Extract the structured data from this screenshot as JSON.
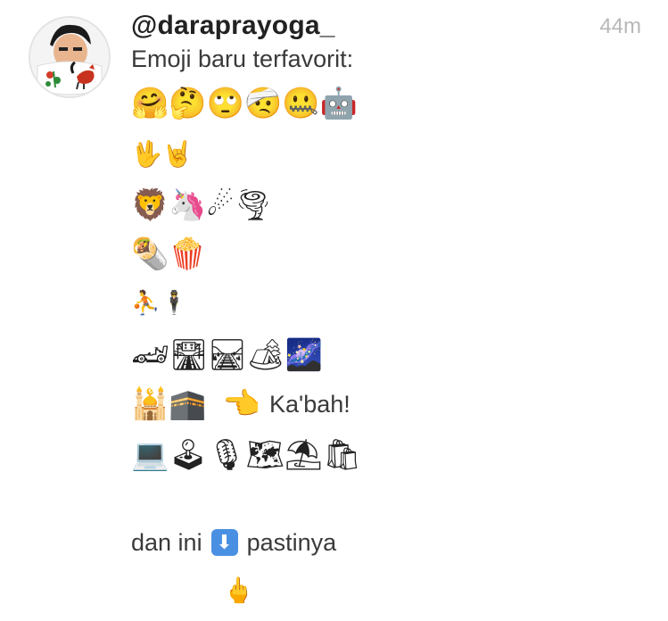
{
  "post": {
    "username": "@daraprayoga_",
    "timestamp": "44m",
    "caption": "Emoji baru terfavorit:",
    "rows": [
      {
        "emojis": "🤗🤔🙄🤕🤐🤖"
      },
      {
        "emojis": "🖖🤘"
      },
      {
        "emojis": "🦁🦄☄🌪"
      },
      {
        "emojis": "🌯🍿"
      },
      {
        "emojis": "⛹🕴"
      },
      {
        "emojis": "🏎🛣🛤🏕🌌"
      },
      {
        "emojis_a": "🕌🕋",
        "emojis_b": "👈",
        "text": "Ka'bah!"
      },
      {
        "emojis": "💻🕹🎙🗺⛱🛍"
      }
    ],
    "closing_text_a": "dan ini",
    "closing_arrow": "⬇",
    "closing_text_b": "pastinya",
    "final_emoji": "🖕"
  }
}
